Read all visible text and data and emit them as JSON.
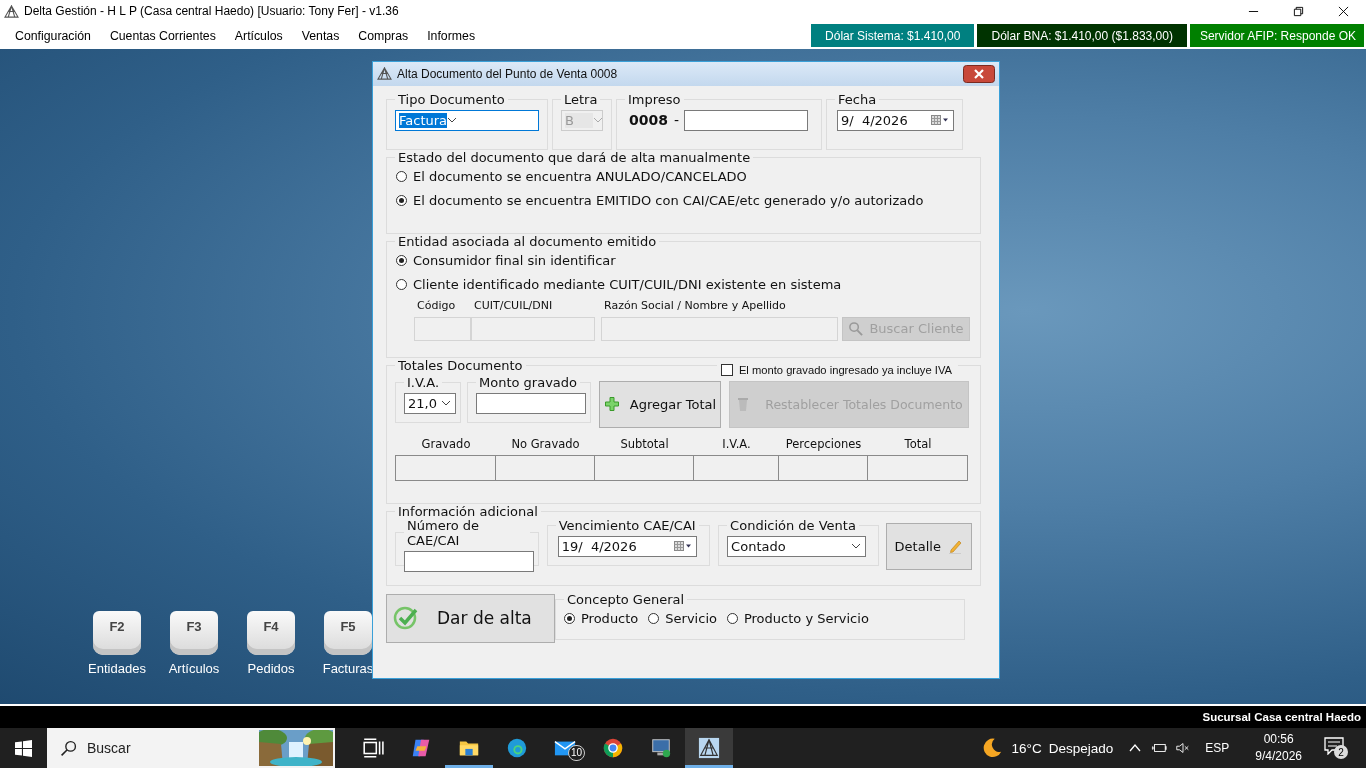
{
  "window": {
    "title": "Delta Gestión - H L P (Casa central Haedo) [Usuario: Tony Fer] - v1.36"
  },
  "menu": [
    "Configuración",
    "Cuentas Corrientes",
    "Artículos",
    "Ventas",
    "Compras",
    "Informes"
  ],
  "status_badges": [
    {
      "text": "Dólar Sistema: $1.410,00",
      "color": "#008080"
    },
    {
      "text": "Dólar BNA: $1.410,00 ($1.833,00)",
      "color": "#003300"
    },
    {
      "text": "Servidor AFIP:  Responde OK",
      "color": "#008000"
    }
  ],
  "desktop_shortcuts": [
    {
      "key": "F2",
      "label": "Entidades"
    },
    {
      "key": "F3",
      "label": "Artículos"
    },
    {
      "key": "F4",
      "label": "Pedidos"
    },
    {
      "key": "F5",
      "label": "Facturas"
    }
  ],
  "dialog": {
    "title": "Alta Documento del Punto de Venta 0008",
    "tipo_documento": {
      "label": "Tipo Documento",
      "value": "Factura"
    },
    "letra": {
      "label": "Letra",
      "value": "B",
      "disabled": true
    },
    "impreso": {
      "label": "Impreso",
      "prefix": "0008",
      "separator": "-"
    },
    "fecha": {
      "label": "Fecha",
      "value": "9/  4/2026"
    },
    "estado": {
      "legend": "Estado del documento que dará de alta manualmente",
      "options": [
        {
          "label": "El documento se encuentra ANULADO/CANCELADO",
          "selected": false
        },
        {
          "label": "El documento se encuentra EMITIDO con CAI/CAE/etc generado y/o autorizado",
          "selected": true
        }
      ]
    },
    "entidad": {
      "legend": "Entidad asociada al documento emitido",
      "options": [
        {
          "label": "Consumidor final sin identificar",
          "selected": true
        },
        {
          "label": "Cliente identificado mediante CUIT/CUIL/DNI existente en sistema",
          "selected": false
        }
      ],
      "columns": [
        "Código",
        "CUIT/CUIL/DNI",
        "Razón Social / Nombre y Apellido"
      ],
      "search_button": {
        "label": "Buscar Cliente",
        "disabled": true
      }
    },
    "totales": {
      "legend": "Totales Documento",
      "includes_iva": {
        "label": "El monto gravado ingresado ya incluye IVA",
        "checked": false
      },
      "iva": {
        "label": "I.V.A.",
        "value": "21,0"
      },
      "monto": {
        "label": "Monto gravado"
      },
      "add_button": {
        "label": "Agregar Total",
        "disabled": false
      },
      "reset_button": {
        "label": "Restablecer Totales Documento",
        "disabled": true
      },
      "columns": [
        "Gravado",
        "No Gravado",
        "Subtotal",
        "I.V.A.",
        "Percepciones",
        "Total"
      ]
    },
    "adicional": {
      "legend": "Información adicional",
      "cae": {
        "label": "Número de CAE/CAI"
      },
      "vencimiento": {
        "label": "Vencimiento CAE/CAI",
        "value": "19/  4/2026"
      },
      "condicion": {
        "label": "Condición de Venta",
        "value": "Contado"
      },
      "detalle_button": {
        "label": "Detalle"
      }
    },
    "submit_button": {
      "label": "Dar de alta"
    },
    "concepto": {
      "legend": "Concepto General",
      "options": [
        {
          "label": "Producto",
          "selected": true
        },
        {
          "label": "Servicio",
          "selected": false
        },
        {
          "label": "Producto y Servicio",
          "selected": false
        }
      ]
    }
  },
  "status_strip": "Sucursal Casa central Haedo",
  "taskbar": {
    "search_placeholder": "Buscar",
    "mail_badge": "10",
    "weather_temp": "16°C",
    "weather_text": "Despejado",
    "language": "ESP",
    "time": "00:56",
    "date": "9/4/2026",
    "notifications": "2"
  }
}
